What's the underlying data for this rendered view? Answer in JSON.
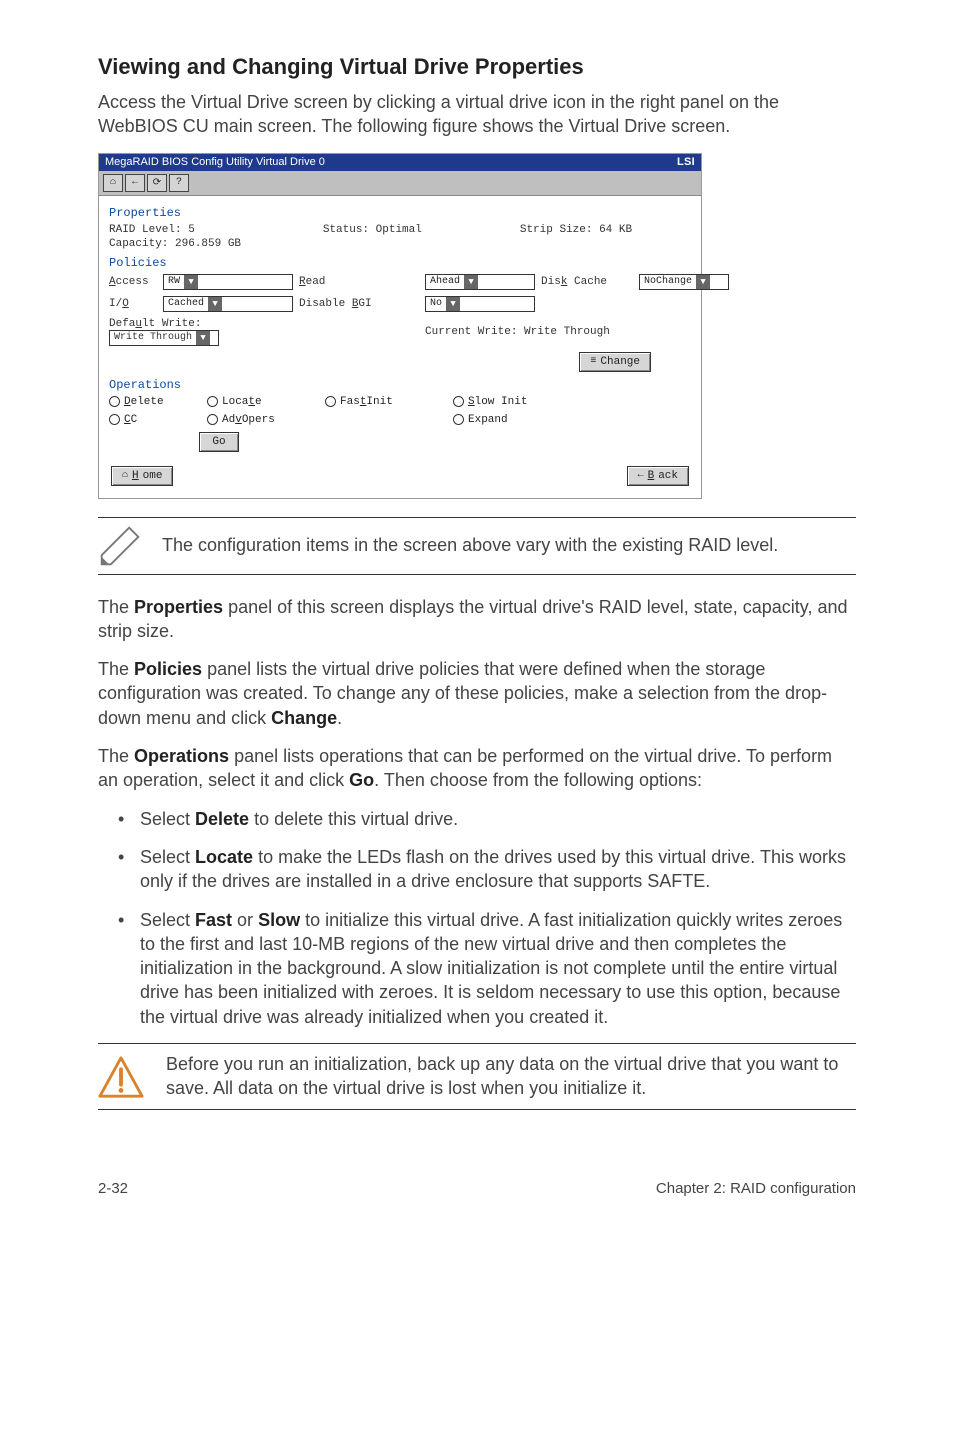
{
  "heading": "Viewing and Changing Virtual Drive Properties",
  "intro": "Access the Virtual Drive screen by clicking a virtual drive icon in the right panel on the WebBIOS CU main screen. The following figure shows the Virtual Drive screen.",
  "screenshot": {
    "title": "MegaRAID BIOS Config Utility Virtual Drive 0",
    "brand": "LSI",
    "toolbar_icons": [
      "home-icon",
      "back-icon",
      "refresh-icon",
      "help-icon"
    ],
    "properties": {
      "panel_label": "Properties",
      "raid_level_label": "RAID Level: 5",
      "status_label": "Status: Optimal",
      "strip_label": "Strip Size: 64 KB",
      "capacity_label": "Capacity: 296.859 GB"
    },
    "policies": {
      "panel_label": "Policies",
      "access_label": "Access",
      "access_value": "RW",
      "read_label": "Read",
      "read_value": "Ahead",
      "disk_cache_label": "Disk Cache",
      "disk_cache_value": "NoChange",
      "io_label": "I/O",
      "io_value": "Cached",
      "disable_bgi_label": "Disable BGI",
      "disable_bgi_value": "No",
      "default_write_label": "Default Write:",
      "default_write_value": "Write Through",
      "current_write_label": "Current Write: Write Through",
      "change_button": "Change"
    },
    "operations": {
      "panel_label": "Operations",
      "items": [
        "Delete",
        "Locate",
        "Fast Init",
        "Slow Init",
        "CC",
        "Adv Opers",
        "Expand"
      ],
      "go_button": "Go"
    },
    "home_button": "Home",
    "back_button": "Back"
  },
  "pencil_note": "The configuration items in the screen above vary with the existing RAID level.",
  "para_properties_pre": "The ",
  "para_properties_bold": "Properties",
  "para_properties_post": " panel of this screen displays the virtual drive's RAID level, state, capacity, and strip size.",
  "para_policies_pre": "The ",
  "para_policies_bold": "Policies",
  "para_policies_mid": " panel lists the virtual drive policies that were defined when the storage configuration was created. To change any of these policies, make a selection from the drop-down menu and click ",
  "para_policies_bold2": "Change",
  "para_policies_post": ".",
  "para_ops_pre": "The ",
  "para_ops_bold": "Operations",
  "para_ops_mid": " panel lists operations that can be performed on the virtual drive. To perform an operation, select it and click ",
  "para_ops_bold2": "Go",
  "para_ops_post": ". Then choose from the following options:",
  "bullets": {
    "b1_pre": "Select ",
    "b1_bold": "Delete",
    "b1_post": " to delete this virtual drive.",
    "b2_pre": "Select ",
    "b2_bold": "Locate",
    "b2_post": " to make the LEDs flash on the drives used by this virtual drive. This works only if the drives are installed in a drive enclosure that supports SAFTE.",
    "b3_pre": "Select ",
    "b3_bold1": "Fast",
    "b3_mid": " or ",
    "b3_bold2": "Slow",
    "b3_post": " to initialize this virtual drive. A fast initialization quickly writes zeroes to the first and last 10-MB regions of the new virtual drive and then completes the initialization in the background. A slow initialization is not complete until the entire virtual drive has been initialized with zeroes. It is seldom necessary to use this option, because the virtual drive was already initialized when you created it."
  },
  "warning_note": "Before you run an initialization, back up any data on the virtual drive that you want to save. All data on the virtual drive is lost when you initialize it.",
  "footer_left": "2-32",
  "footer_right": "Chapter 2: RAID configuration"
}
